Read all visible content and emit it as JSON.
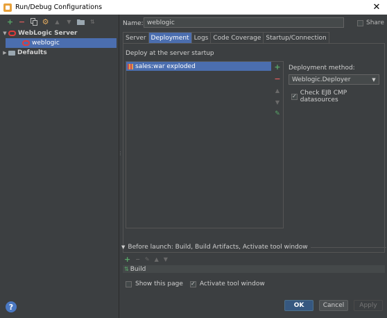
{
  "window": {
    "title": "Run/Debug Configurations",
    "close_glyph": "✕"
  },
  "left_toolbar": {
    "icons": [
      "add-icon",
      "remove-icon",
      "copy-icon",
      "settings-icon",
      "move-up-icon",
      "move-down-icon",
      "folder-icon",
      "sort-icon"
    ]
  },
  "tree": {
    "group_label": "WebLogic Server",
    "child_label": "weblogic",
    "defaults_label": "Defaults"
  },
  "help_label": "?",
  "name": {
    "label": "Name:",
    "value": "weblogic"
  },
  "share_label": "Share",
  "tabs": [
    "Server",
    "Deployment",
    "Logs",
    "Code Coverage",
    "Startup/Connection"
  ],
  "deployment": {
    "section_label": "Deploy at the server startup",
    "artifacts": [
      "sales:war exploded"
    ],
    "method_label": "Deployment method:",
    "method_value": "Weblogic.Deployer",
    "cmp_check_label": "Check EJB CMP datasources",
    "cmp_checked": true
  },
  "before_launch": {
    "header": "Before launch: Build, Build Artifacts, Activate tool window",
    "tasks": [
      "Build"
    ]
  },
  "bottom": {
    "show_page_label": "Show this page",
    "show_page_checked": false,
    "activate_label": "Activate tool window",
    "activate_checked": true
  },
  "buttons": {
    "ok": "OK",
    "cancel": "Cancel",
    "apply": "Apply"
  },
  "colors": {
    "selection": "#4b6eaf",
    "background": "#3c3f41",
    "add": "#59a869",
    "remove": "#d75b5b",
    "weblogic": "#e23b3b"
  }
}
